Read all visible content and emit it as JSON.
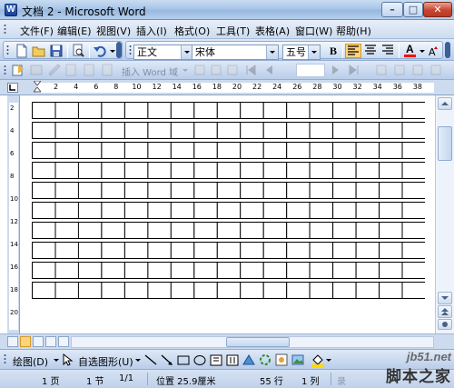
{
  "window": {
    "title": "文档 2 - Microsoft Word",
    "app_icon_letter": "W"
  },
  "menubar": {
    "items": [
      "文件(F)",
      "编辑(E)",
      "视图(V)",
      "插入(I)",
      "格式(O)",
      "工具(T)",
      "表格(A)",
      "窗口(W)",
      "帮助(H)"
    ]
  },
  "formatting": {
    "style": "正文",
    "font": "宋体",
    "size": "五号",
    "bold": "B",
    "font_color_letter": "A"
  },
  "mailmerge": {
    "insert_word_field": "插入 Word 域"
  },
  "ruler": {
    "h_ticks": [
      "2",
      "4",
      "6",
      "8",
      "10",
      "12",
      "14",
      "16",
      "18",
      "20",
      "22",
      "24",
      "26",
      "28",
      "30",
      "32",
      "34",
      "36",
      "38"
    ],
    "v_ticks": [
      "2",
      "4",
      "6",
      "8",
      "10",
      "12",
      "14",
      "16",
      "18",
      "20"
    ]
  },
  "drawing": {
    "draw_menu": "绘图(D)",
    "autoshapes": "自选图形(U)"
  },
  "status": {
    "page": "1 页",
    "section": "1 节",
    "page_of": "1/1",
    "position": "位置 25.9厘米",
    "line": "55 行",
    "column": "1 列",
    "record": "录"
  },
  "watermark": {
    "site": "jb51.net",
    "name": "脚本之家"
  },
  "colors": {
    "font_color": "#ff0000",
    "highlight": "#ffd37a",
    "accent": "#2b579a"
  }
}
